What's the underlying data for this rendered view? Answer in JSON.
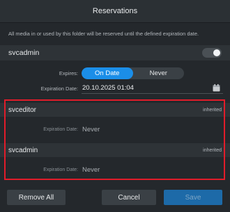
{
  "dialog": {
    "title": "Reservations",
    "info": "All media in or used by this folder will be reserved until the defined expiration date.",
    "current_user": {
      "name": "svcadmin",
      "toggle_on": false
    },
    "expires": {
      "label": "Expires:",
      "options": [
        "On Date",
        "Never"
      ],
      "selected": "On Date"
    },
    "expiration_date": {
      "label": "Expiration Date:",
      "value": "20.10.2025 01:04",
      "icon": "calendar-icon"
    },
    "reservations": [
      {
        "user": "svceditor",
        "tag": "inherited",
        "exp_label": "Expiration Date:",
        "exp_value": "Never"
      },
      {
        "user": "svcadmin",
        "tag": "inherited",
        "exp_label": "Expiration Date:",
        "exp_value": "Never"
      }
    ],
    "buttons": {
      "remove_all": "Remove All",
      "cancel": "Cancel",
      "save": "Save"
    },
    "colors": {
      "accent": "#1b8ee8",
      "highlight_border": "#e11c2a",
      "save_disabled": "#1d6aa8"
    }
  }
}
